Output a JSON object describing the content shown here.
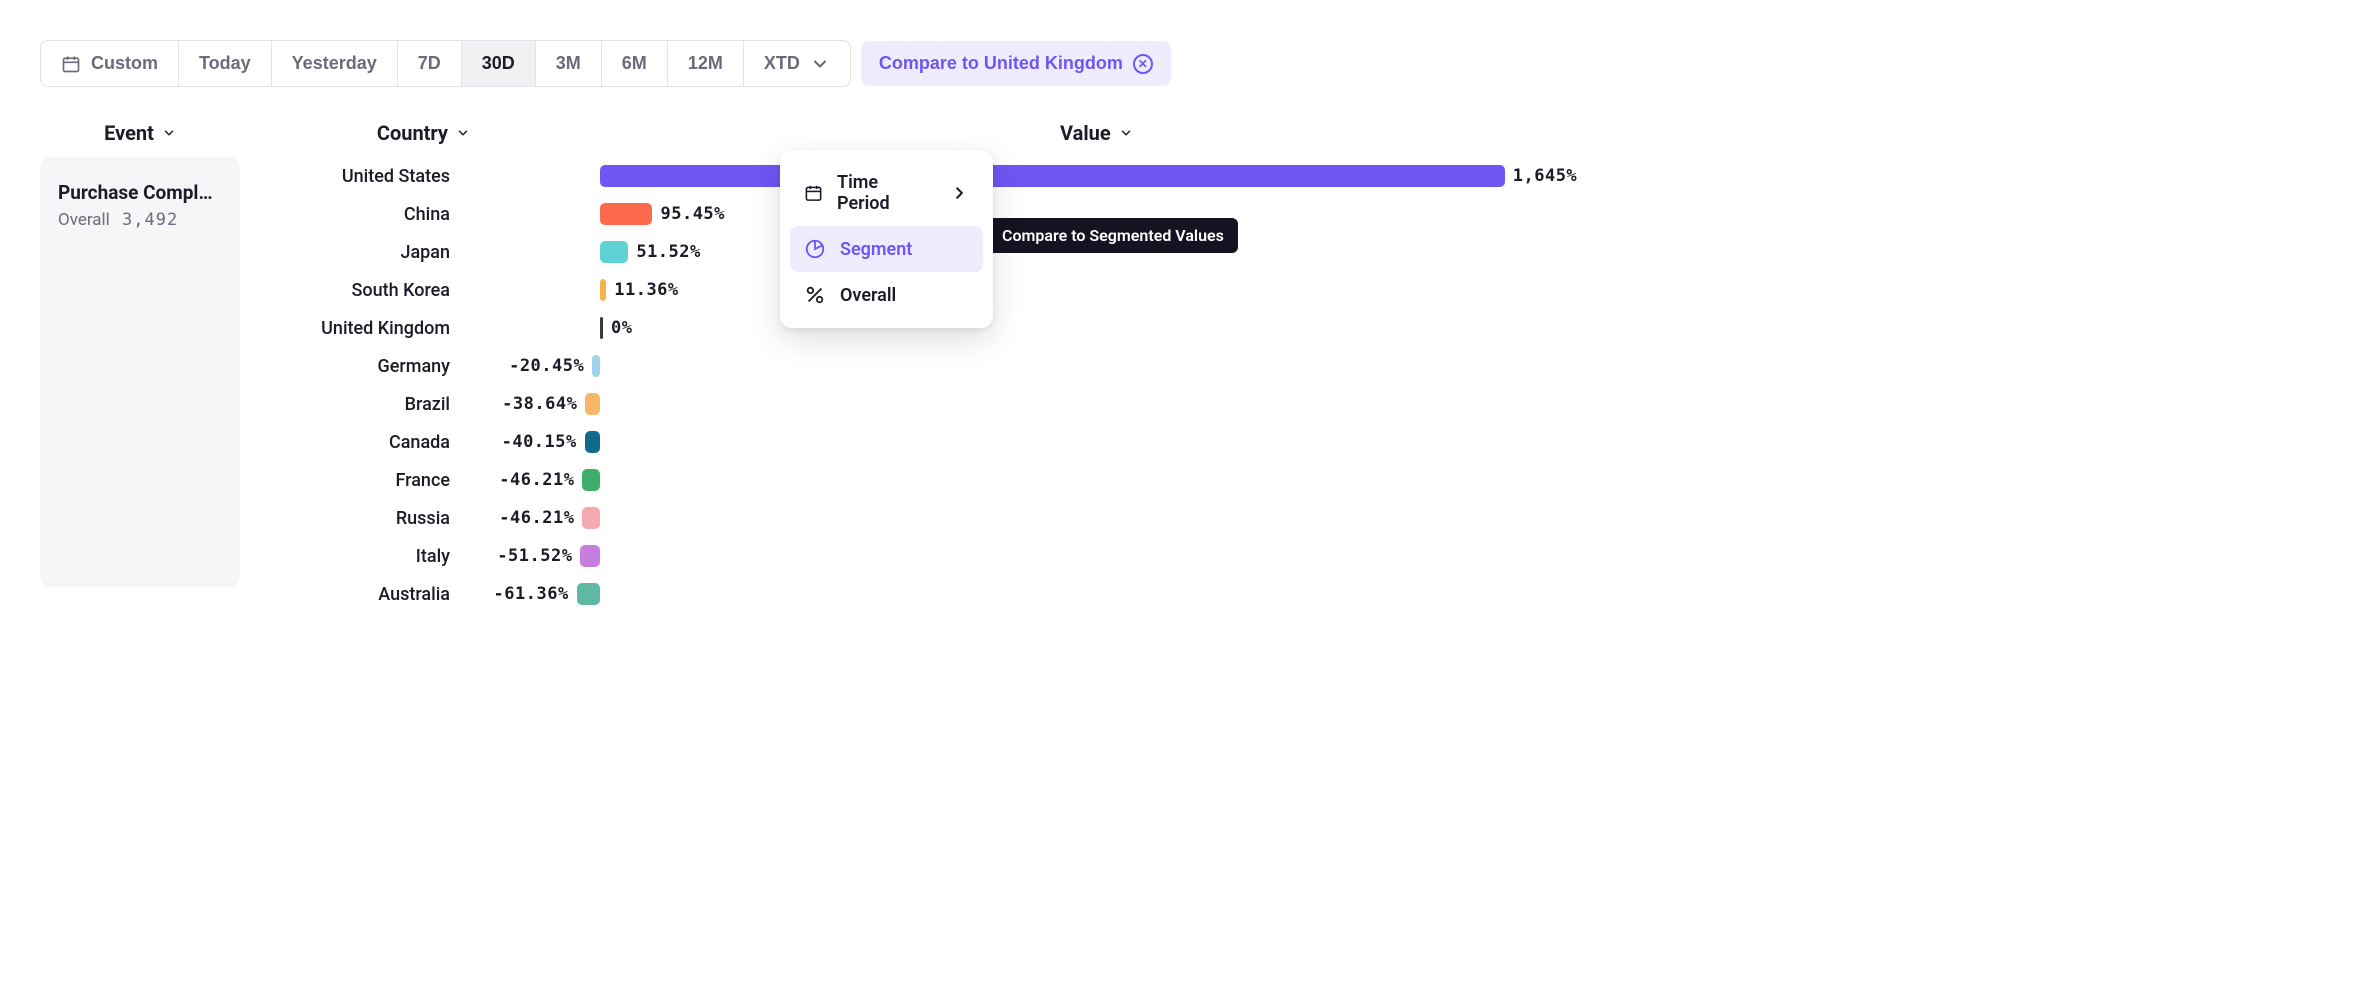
{
  "toolbar": {
    "ranges": [
      "Custom",
      "Today",
      "Yesterday",
      "7D",
      "30D",
      "3M",
      "6M",
      "12M",
      "XTD"
    ],
    "active_range": "30D",
    "compare_label": "Compare to United Kingdom"
  },
  "headers": {
    "event": "Event",
    "country": "Country",
    "value": "Value"
  },
  "event_card": {
    "title": "Purchase Compl…",
    "subtitle_label": "Overall",
    "subtitle_value": "3,492"
  },
  "popover": {
    "items": [
      {
        "icon": "calendar",
        "label": "Time Period",
        "has_sub": true
      },
      {
        "icon": "segment",
        "label": "Segment",
        "selected": true
      },
      {
        "icon": "percent",
        "label": "Overall"
      }
    ],
    "tooltip": "Compare to Segmented Values"
  },
  "chart_data": {
    "type": "bar",
    "orientation": "horizontal",
    "baseline": "United Kingdom",
    "xlabel": "",
    "ylabel": "",
    "series": [
      {
        "name": "United States",
        "value": 1645,
        "display": "1,645%",
        "color": "#6d56f2"
      },
      {
        "name": "China",
        "value": 95.45,
        "display": "95.45%",
        "color": "#fb6b4b"
      },
      {
        "name": "Japan",
        "value": 51.52,
        "display": "51.52%",
        "color": "#5fd2d6"
      },
      {
        "name": "South Korea",
        "value": 11.36,
        "display": "11.36%",
        "color": "#f7b24b"
      },
      {
        "name": "United Kingdom",
        "value": 0,
        "display": "0%",
        "color": "#3a3a46"
      },
      {
        "name": "Germany",
        "value": -20.45,
        "display": "-20.45%",
        "color": "#9fd2ef"
      },
      {
        "name": "Brazil",
        "value": -38.64,
        "display": "-38.64%",
        "color": "#f6b867"
      },
      {
        "name": "Canada",
        "value": -40.15,
        "display": "-40.15%",
        "color": "#0f6a8c"
      },
      {
        "name": "France",
        "value": -46.21,
        "display": "-46.21%",
        "color": "#3fae6b"
      },
      {
        "name": "Russia",
        "value": -46.21,
        "display": "-46.21%",
        "color": "#f3aab0"
      },
      {
        "name": "Italy",
        "value": -51.52,
        "display": "-51.52%",
        "color": "#c77de0"
      },
      {
        "name": "Australia",
        "value": -61.36,
        "display": "-61.36%",
        "color": "#5fb8a3"
      }
    ]
  }
}
